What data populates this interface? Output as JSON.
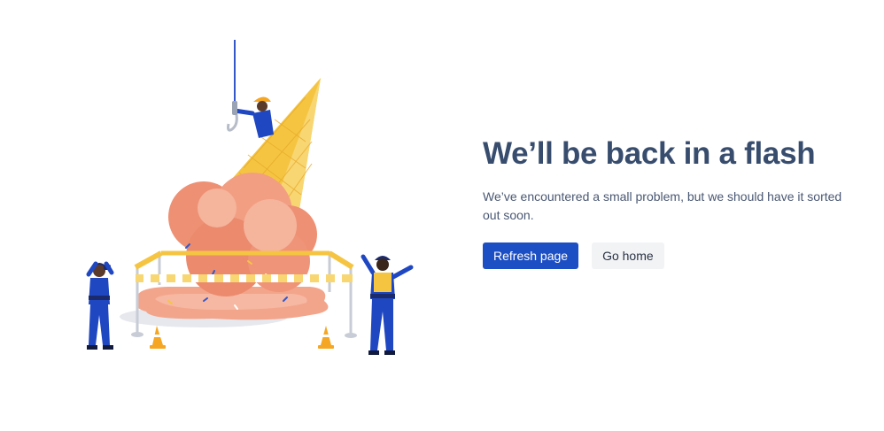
{
  "error": {
    "title": "We’ll be back in a flash",
    "message": "We’ve encountered a small problem, but we should have it sorted out soon."
  },
  "actions": {
    "refresh_label": "Refresh page",
    "home_label": "Go home"
  },
  "colors": {
    "title": "#384d6e",
    "body_text": "#4a5873",
    "primary_button": "#1d4fc4",
    "secondary_button": "#f2f3f5",
    "ice_cream": "#ef9a7e",
    "cone": "#f5c542",
    "uniform": "#1f47c2"
  },
  "illustration": {
    "icon": "dropped-ice-cream-illustration"
  }
}
